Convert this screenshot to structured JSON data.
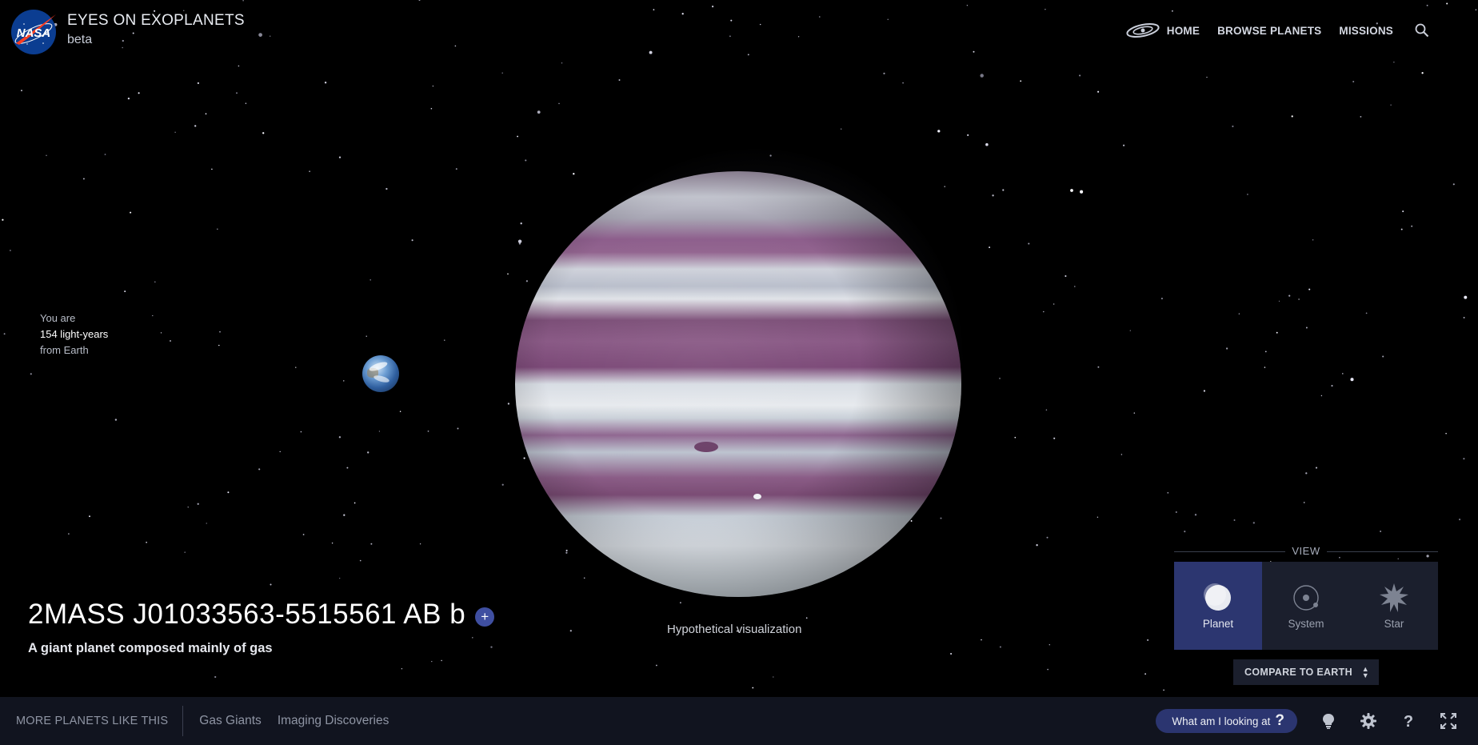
{
  "header": {
    "logo_text": "NASA",
    "title": "EYES ON EXOPLANETS",
    "subtitle": "beta"
  },
  "nav": {
    "items": [
      {
        "label": "HOME",
        "icon": "galaxy-icon"
      },
      {
        "label": "BROWSE PLANETS"
      },
      {
        "label": "MISSIONS"
      }
    ],
    "search_icon": "search-icon"
  },
  "distance": {
    "line1": "You are",
    "value": "154 light-years",
    "line3": "from Earth"
  },
  "planet": {
    "name": "2MASS J01033563-5515561 AB b",
    "description": "A giant planet composed mainly of gas",
    "visualization_note": "Hypothetical visualization",
    "add_label": "+"
  },
  "view_panel": {
    "title": "VIEW",
    "options": [
      {
        "label": "Planet",
        "icon": "planet-icon",
        "active": true
      },
      {
        "label": "System",
        "icon": "system-orbit-icon",
        "active": false
      },
      {
        "label": "Star",
        "icon": "star-icon",
        "active": false
      }
    ],
    "compare_label": "COMPARE TO EARTH"
  },
  "footer": {
    "more_label": "MORE PLANETS LIKE THIS",
    "links": [
      "Gas Giants",
      "Imaging Discoveries"
    ],
    "what_label": "What am I looking at",
    "what_icon": "?",
    "icons": [
      "lightbulb-icon",
      "settings-gear-icon",
      "help-icon",
      "fullscreen-icon"
    ]
  },
  "colors": {
    "accent": "#2c3670",
    "accent_button": "#3f4fa1",
    "footer_bg": "#11141f",
    "background": "#000000"
  }
}
